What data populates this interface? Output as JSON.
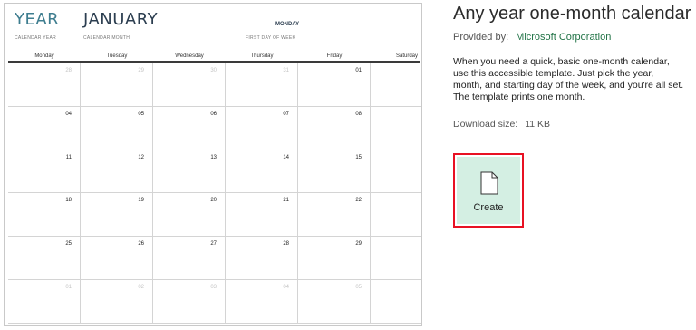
{
  "preview": {
    "year_value": "YEAR",
    "year_label": "CALENDAR YEAR",
    "month_value": "JANUARY",
    "month_label": "CALENDAR MONTH",
    "first_day_value": "MONDAY",
    "first_day_label": "FIRST DAY OF WEEK",
    "day_names": [
      "Monday",
      "Tuesday",
      "Wednesday",
      "Thursday",
      "Friday",
      "Saturday"
    ],
    "weeks": [
      [
        {
          "d": "28",
          "dim": true
        },
        {
          "d": "29",
          "dim": true
        },
        {
          "d": "30",
          "dim": true
        },
        {
          "d": "31",
          "dim": true
        },
        {
          "d": "01",
          "dim": false
        },
        {
          "d": "",
          "dim": false
        }
      ],
      [
        {
          "d": "04",
          "dim": false
        },
        {
          "d": "05",
          "dim": false
        },
        {
          "d": "06",
          "dim": false
        },
        {
          "d": "07",
          "dim": false
        },
        {
          "d": "08",
          "dim": false
        },
        {
          "d": "",
          "dim": false
        }
      ],
      [
        {
          "d": "11",
          "dim": false
        },
        {
          "d": "12",
          "dim": false
        },
        {
          "d": "13",
          "dim": false
        },
        {
          "d": "14",
          "dim": false
        },
        {
          "d": "15",
          "dim": false
        },
        {
          "d": "",
          "dim": false
        }
      ],
      [
        {
          "d": "18",
          "dim": false
        },
        {
          "d": "19",
          "dim": false
        },
        {
          "d": "20",
          "dim": false
        },
        {
          "d": "21",
          "dim": false
        },
        {
          "d": "22",
          "dim": false
        },
        {
          "d": "",
          "dim": false
        }
      ],
      [
        {
          "d": "25",
          "dim": false
        },
        {
          "d": "26",
          "dim": false
        },
        {
          "d": "27",
          "dim": false
        },
        {
          "d": "28",
          "dim": false
        },
        {
          "d": "29",
          "dim": false
        },
        {
          "d": "",
          "dim": false
        }
      ],
      [
        {
          "d": "01",
          "dim": true
        },
        {
          "d": "02",
          "dim": true
        },
        {
          "d": "03",
          "dim": true
        },
        {
          "d": "04",
          "dim": true
        },
        {
          "d": "05",
          "dim": true
        },
        {
          "d": "",
          "dim": false
        }
      ]
    ]
  },
  "details": {
    "title": "Any year one-month calendar",
    "provided_by_label": "Provided by:",
    "provider_name": "Microsoft Corporation",
    "description": "When you need a quick, basic one-month calendar, use this accessible template. Just pick the year, month, and starting day of the week, and you're all set. The template prints one month.",
    "download_size_label": "Download size:",
    "download_size_value": "11 KB",
    "create_label": "Create",
    "create_icon": "document-icon"
  },
  "colors": {
    "provider": "#217346",
    "create_bg": "#d4efe3",
    "create_border": "#e81123",
    "year_accent": "#3e7d8f"
  }
}
